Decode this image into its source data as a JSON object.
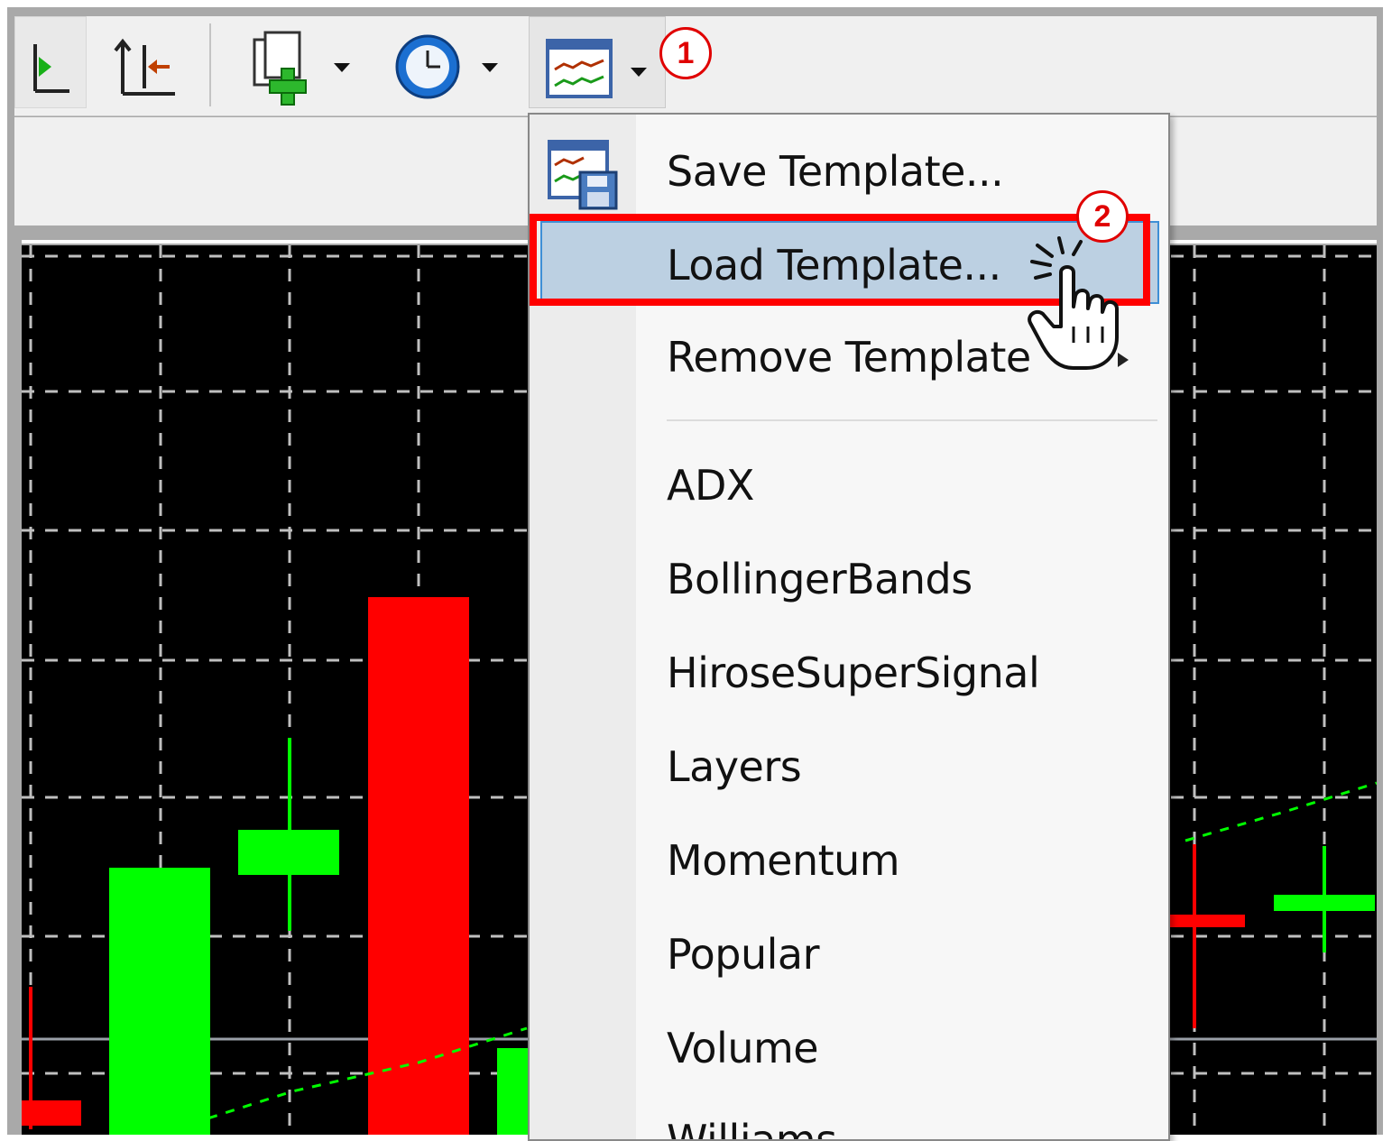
{
  "toolbar": {
    "buttons": [
      {
        "name": "play-chart-icon"
      },
      {
        "name": "chart-shift-icon"
      },
      {
        "name": "new-chart-icon"
      },
      {
        "name": "clock-periods-icon"
      },
      {
        "name": "templates-icon"
      }
    ]
  },
  "callouts": {
    "step1": "1",
    "step2": "2"
  },
  "template_menu": {
    "items": [
      {
        "label": "Save Template..."
      },
      {
        "label": "Load Template..."
      },
      {
        "label": "Remove Template"
      },
      {
        "label": "ADX"
      },
      {
        "label": "BollingerBands"
      },
      {
        "label": "HiroseSuperSignal"
      },
      {
        "label": "Layers"
      },
      {
        "label": "Momentum"
      },
      {
        "label": "Popular"
      },
      {
        "label": "Volume"
      },
      {
        "label": "Williams"
      }
    ],
    "highlighted_item": "Load Template..."
  },
  "colors": {
    "bull_candle": "#00ff00",
    "bear_candle": "#ff0000",
    "chart_background": "#000000",
    "grid": "#bfbfbf",
    "highlight": "#bcd0e2",
    "callout": "#e00000"
  }
}
